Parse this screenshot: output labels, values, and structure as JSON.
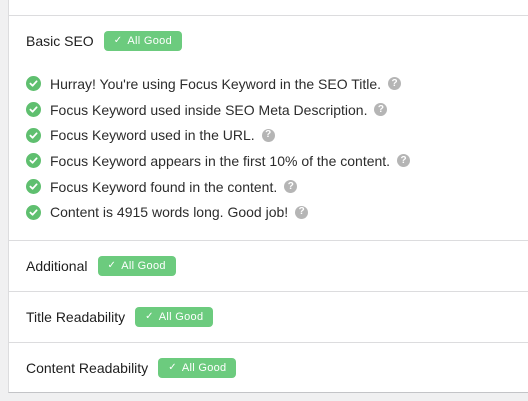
{
  "sections": [
    {
      "title": "Basic SEO",
      "badge": "All Good",
      "checks": [
        {
          "text": "Hurray! You're using Focus Keyword in the SEO Title."
        },
        {
          "text": "Focus Keyword used inside SEO Meta Description."
        },
        {
          "text": "Focus Keyword used in the URL."
        },
        {
          "text": "Focus Keyword appears in the first 10% of the content."
        },
        {
          "text": "Focus Keyword found in the content."
        },
        {
          "text": "Content is 4915 words long. Good job!"
        }
      ]
    },
    {
      "title": "Additional",
      "badge": "All Good"
    },
    {
      "title": "Title Readability",
      "badge": "All Good"
    },
    {
      "title": "Content Readability",
      "badge": "All Good"
    }
  ],
  "icons": {
    "badge_check": "✓",
    "help": "?"
  },
  "colors": {
    "badge": "#6ccb7e",
    "check_ok": "#5fbf6f",
    "help_icon": "#b5b5b5"
  }
}
